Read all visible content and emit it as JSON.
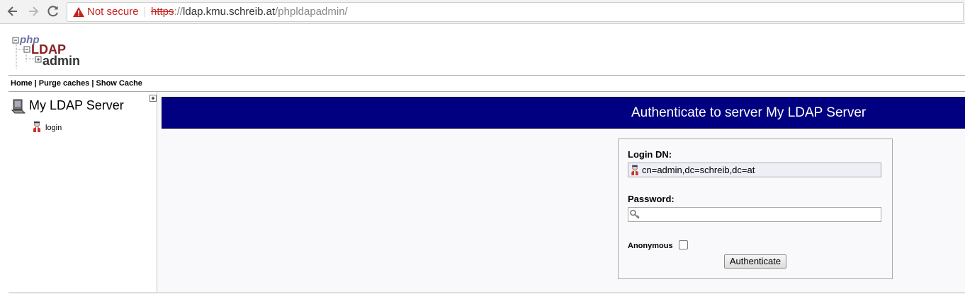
{
  "browser": {
    "security_label": "Not secure",
    "url_scheme": "https",
    "url_scheme_sep": "://",
    "url_host": "ldap.kmu.schreib.at",
    "url_path": "/phpldapadmin/"
  },
  "logo": {
    "line1": "php",
    "line2": "LDAP",
    "line3": "admin"
  },
  "menu": {
    "home": "Home",
    "sep1": " | ",
    "purge": "Purge caches",
    "sep2": " | ",
    "show_cache": "Show Cache"
  },
  "tree": {
    "toggle": "+",
    "server_name": "My LDAP Server",
    "login_link": "login"
  },
  "main": {
    "banner_title": "Authenticate to server My LDAP Server"
  },
  "form": {
    "login_dn_label": "Login DN:",
    "login_dn_value": "cn=admin,dc=schreib,dc=at",
    "password_label": "Password:",
    "password_value": "",
    "anonymous_label": "Anonymous",
    "anonymous_checked": false,
    "submit_label": "Authenticate"
  },
  "colors": {
    "banner_bg": "#000080",
    "insecure_red": "#c5221f"
  }
}
